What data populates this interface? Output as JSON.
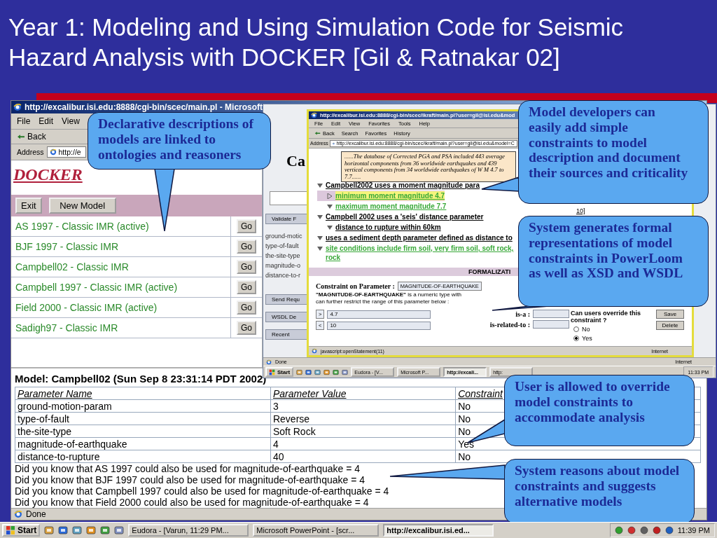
{
  "title": "Year 1: Modeling and Using Simulation Code for Seismic Hazard Analysis with DOCKER [Gil & Ratnakar 02]",
  "main_window": {
    "title": "http://excalibur.isi.edu:8888/cgi-bin/scec/main.pl - Microsoft",
    "menu": [
      "File",
      "Edit",
      "View"
    ],
    "back": "Back",
    "address_label": "Address",
    "address": "http://e",
    "logo": "DOCKER",
    "buttons": [
      "Exit",
      "New Model"
    ],
    "models": [
      {
        "name": "AS 1997 - Classic IMR (active)",
        "button": "Go"
      },
      {
        "name": "BJF 1997 - Classic IMR",
        "button": "Go"
      },
      {
        "name": "Campbell02 - Classic IMR",
        "button": "Go"
      },
      {
        "name": "Campbell 1997 - Classic IMR (active)",
        "button": "Go"
      },
      {
        "name": "Field 2000 - Classic IMR (active)",
        "button": "Go"
      },
      {
        "name": "Sadigh97 - Classic IMR",
        "button": "Go"
      }
    ],
    "model_heading": "Model: Campbell02 (Sun Sep 8 23:31:14 PDT 2002)",
    "table": {
      "columns": [
        "Parameter Name",
        "Parameter Value",
        "Constraint"
      ],
      "rows": [
        [
          "ground-motion-param",
          "3",
          "No"
        ],
        [
          "type-of-fault",
          "Reverse",
          "No"
        ],
        [
          "the-site-type",
          "Soft Rock",
          "No"
        ],
        [
          "magnitude-of-earthquake",
          "4",
          "Yes"
        ],
        [
          "distance-to-rupture",
          "40",
          "No"
        ]
      ]
    },
    "suggestions": [
      "Did you know that AS 1997 could also be used for magnitude-of-earthquake = 4",
      "Did you know that BJF 1997 could also be used for magnitude-of-earthquake = 4",
      "Did you know that Campbell 1997 could also be used for magnitude-of-earthquake = 4",
      "Did you know that Field 2000 could also be used for magnitude-of-earthquake = 4"
    ],
    "status": "Done"
  },
  "inner_desktop": {
    "background_window": {
      "heading": "Ca",
      "buttons": [
        "Validate F",
        "Send Requ",
        "WSDL De",
        "Recent"
      ],
      "params": [
        "ground-motic",
        "type-of-fault",
        "the-site-type",
        "magnitude-o",
        "distance-to-r"
      ]
    },
    "browser": {
      "title": "http://excalibur.isi.edu:8888/cgi-bin/scec/ikraft/main.pl?user=gil@isi.edu&mod",
      "menu": [
        "File",
        "Edit",
        "View",
        "Favorites",
        "Tools",
        "Help"
      ],
      "toolbar": [
        "Back",
        "Search",
        "Favorites",
        "History"
      ],
      "address_label": "Address",
      "address": "http://excalibur.isi.edu:8888/cgi-bin/scec/ikraft/main.pl?user=gil@isi.edu&model=C",
      "tooltip": "......The database of Corrected PGA and PSA included 443 average horizontal components from 36 worldwide earthquakes and 439 vertical components from 34 worldwide earthquakes of W M 4.7 to 7.7......",
      "tree": [
        {
          "label": "Campbell2002 uses a moment magnitude para",
          "kind": "statement",
          "expanded": true,
          "selected": false,
          "children": [
            {
              "label": "minimum moment magnitude 4.7",
              "kind": "constraint",
              "expanded": false,
              "selected": true
            },
            {
              "label": "maximum moment magnitude 7.7",
              "kind": "constraint",
              "expanded": true,
              "selected": false
            }
          ]
        },
        {
          "label": "Campbell 2002 uses a 'seis' distance parameter",
          "kind": "statement",
          "expanded": true,
          "selected": false,
          "children": [
            {
              "label": "distance to rupture within 60km",
              "kind": "statement",
              "expanded": true,
              "selected": false
            }
          ]
        },
        {
          "label": "uses a sediment depth parameter defined as distance to",
          "kind": "statement",
          "expanded": true,
          "selected": false
        },
        {
          "label": "site conditions include firm soil, very firm soil, soft rock, rock",
          "kind": "constraint",
          "expanded": true,
          "selected": false
        }
      ],
      "side_note": "10]",
      "section": "FORMALIZATI",
      "parameter_label": "Constraint on Parameter :",
      "parameter": "MAGNITUDE-OF-EARTHQUAKE",
      "description": [
        "**\"MAGNITUDE-OF-EARTHQUAKE\"** is a numeric type with",
        "can further restrict the range of this parameter below :"
      ],
      "ranges": [
        {
          "operator": ">",
          "value": "4.7"
        },
        {
          "operator": "<",
          "value": "10"
        }
      ],
      "relations": [
        "is-a :",
        "is-related-to :"
      ],
      "override_question": "Can users override this constraint ?",
      "override_options": [
        {
          "label": "No",
          "selected": false
        },
        {
          "label": "Yes",
          "selected": true
        }
      ],
      "actions": [
        "Save",
        "Delete"
      ],
      "status": "javascript:openStatement(11)",
      "zone": "Internet"
    },
    "status": "Done",
    "zone": "Internet",
    "taskbar": {
      "start": "Start",
      "tasks": [
        {
          "label": "Eudora - [V...",
          "selected": false
        },
        {
          "label": "Microsoft P...",
          "selected": false
        },
        {
          "label": "http://excali...",
          "selected": true
        },
        {
          "label": "http:",
          "selected": false
        }
      ],
      "clock": "11:33 PM"
    }
  },
  "callouts": [
    "Declarative descriptions of models are linked to ontologies and reasoners",
    "Model developers can easily add simple constraints to model description and document their sources and criticality",
    "System generates formal representations of model constraints in PowerLoom as well as XSD and WSDL",
    "User is allowed to override model constraints to accommodate analysis",
    "System reasons about model constraints and suggests alternative models"
  ],
  "taskbar": {
    "start": "Start",
    "tasks": [
      {
        "label": "Eudora - [Varun, 11:29 PM...",
        "selected": false
      },
      {
        "label": "Microsoft PowerPoint - [scr...",
        "selected": false
      },
      {
        "label": "http://excalibur.isi.ed...",
        "selected": true
      }
    ],
    "clock": "11:39 PM"
  }
}
